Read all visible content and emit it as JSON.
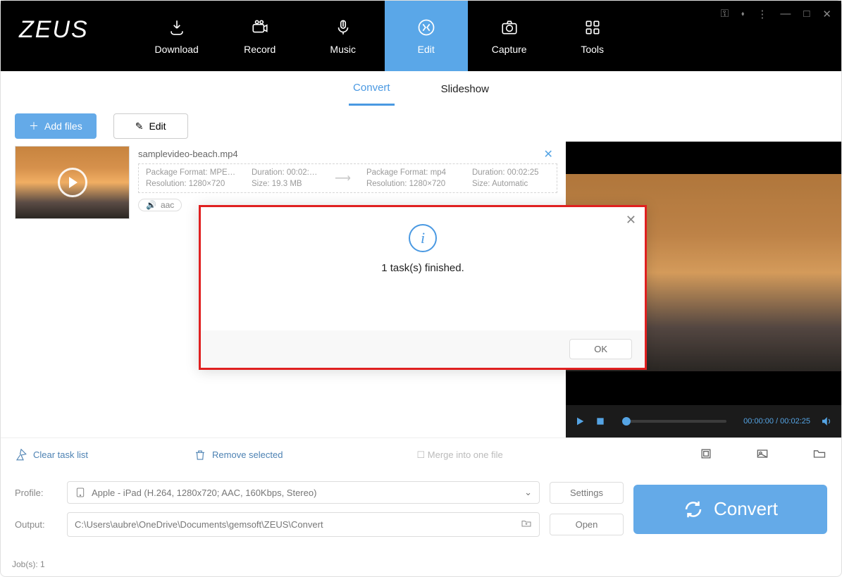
{
  "app": {
    "logo": "ZEUS"
  },
  "nav": {
    "items": [
      {
        "label": "Download",
        "icon": "download-icon"
      },
      {
        "label": "Record",
        "icon": "record-icon"
      },
      {
        "label": "Music",
        "icon": "music-icon"
      },
      {
        "label": "Edit",
        "icon": "edit-icon",
        "active": true
      },
      {
        "label": "Capture",
        "icon": "capture-icon"
      },
      {
        "label": "Tools",
        "icon": "tools-icon"
      }
    ]
  },
  "tabs": {
    "convert": "Convert",
    "slideshow": "Slideshow"
  },
  "actions": {
    "add": "Add files",
    "edit": "Edit"
  },
  "file": {
    "name": "samplevideo-beach.mp4",
    "src": {
      "package": "Package Format: MPE…",
      "resolution": "Resolution: 1280×720",
      "duration": "Duration: 00:02:…",
      "size": "Size: 19.3 MB"
    },
    "dst": {
      "package": "Package Format: mp4",
      "resolution": "Resolution: 1280×720",
      "duration": "Duration: 00:02:25",
      "size": "Size: Automatic"
    },
    "chip": "aac"
  },
  "lowerbar": {
    "clear": "Clear task list",
    "remove": "Remove selected",
    "merge": "Merge into one file"
  },
  "profile": {
    "label": "Profile:",
    "value": "Apple - iPad (H.264, 1280x720; AAC, 160Kbps, Stereo)",
    "settings": "Settings"
  },
  "output": {
    "label": "Output:",
    "value": "C:\\Users\\aubre\\OneDrive\\Documents\\gemsoft\\ZEUS\\Convert",
    "open": "Open"
  },
  "convert_btn": "Convert",
  "preview": {
    "time_current": "00:00:00",
    "time_sep": " / ",
    "time_total": "00:02:25"
  },
  "status": "Job(s): 1",
  "modal": {
    "message": "1 task(s) finished.",
    "ok": "OK"
  }
}
